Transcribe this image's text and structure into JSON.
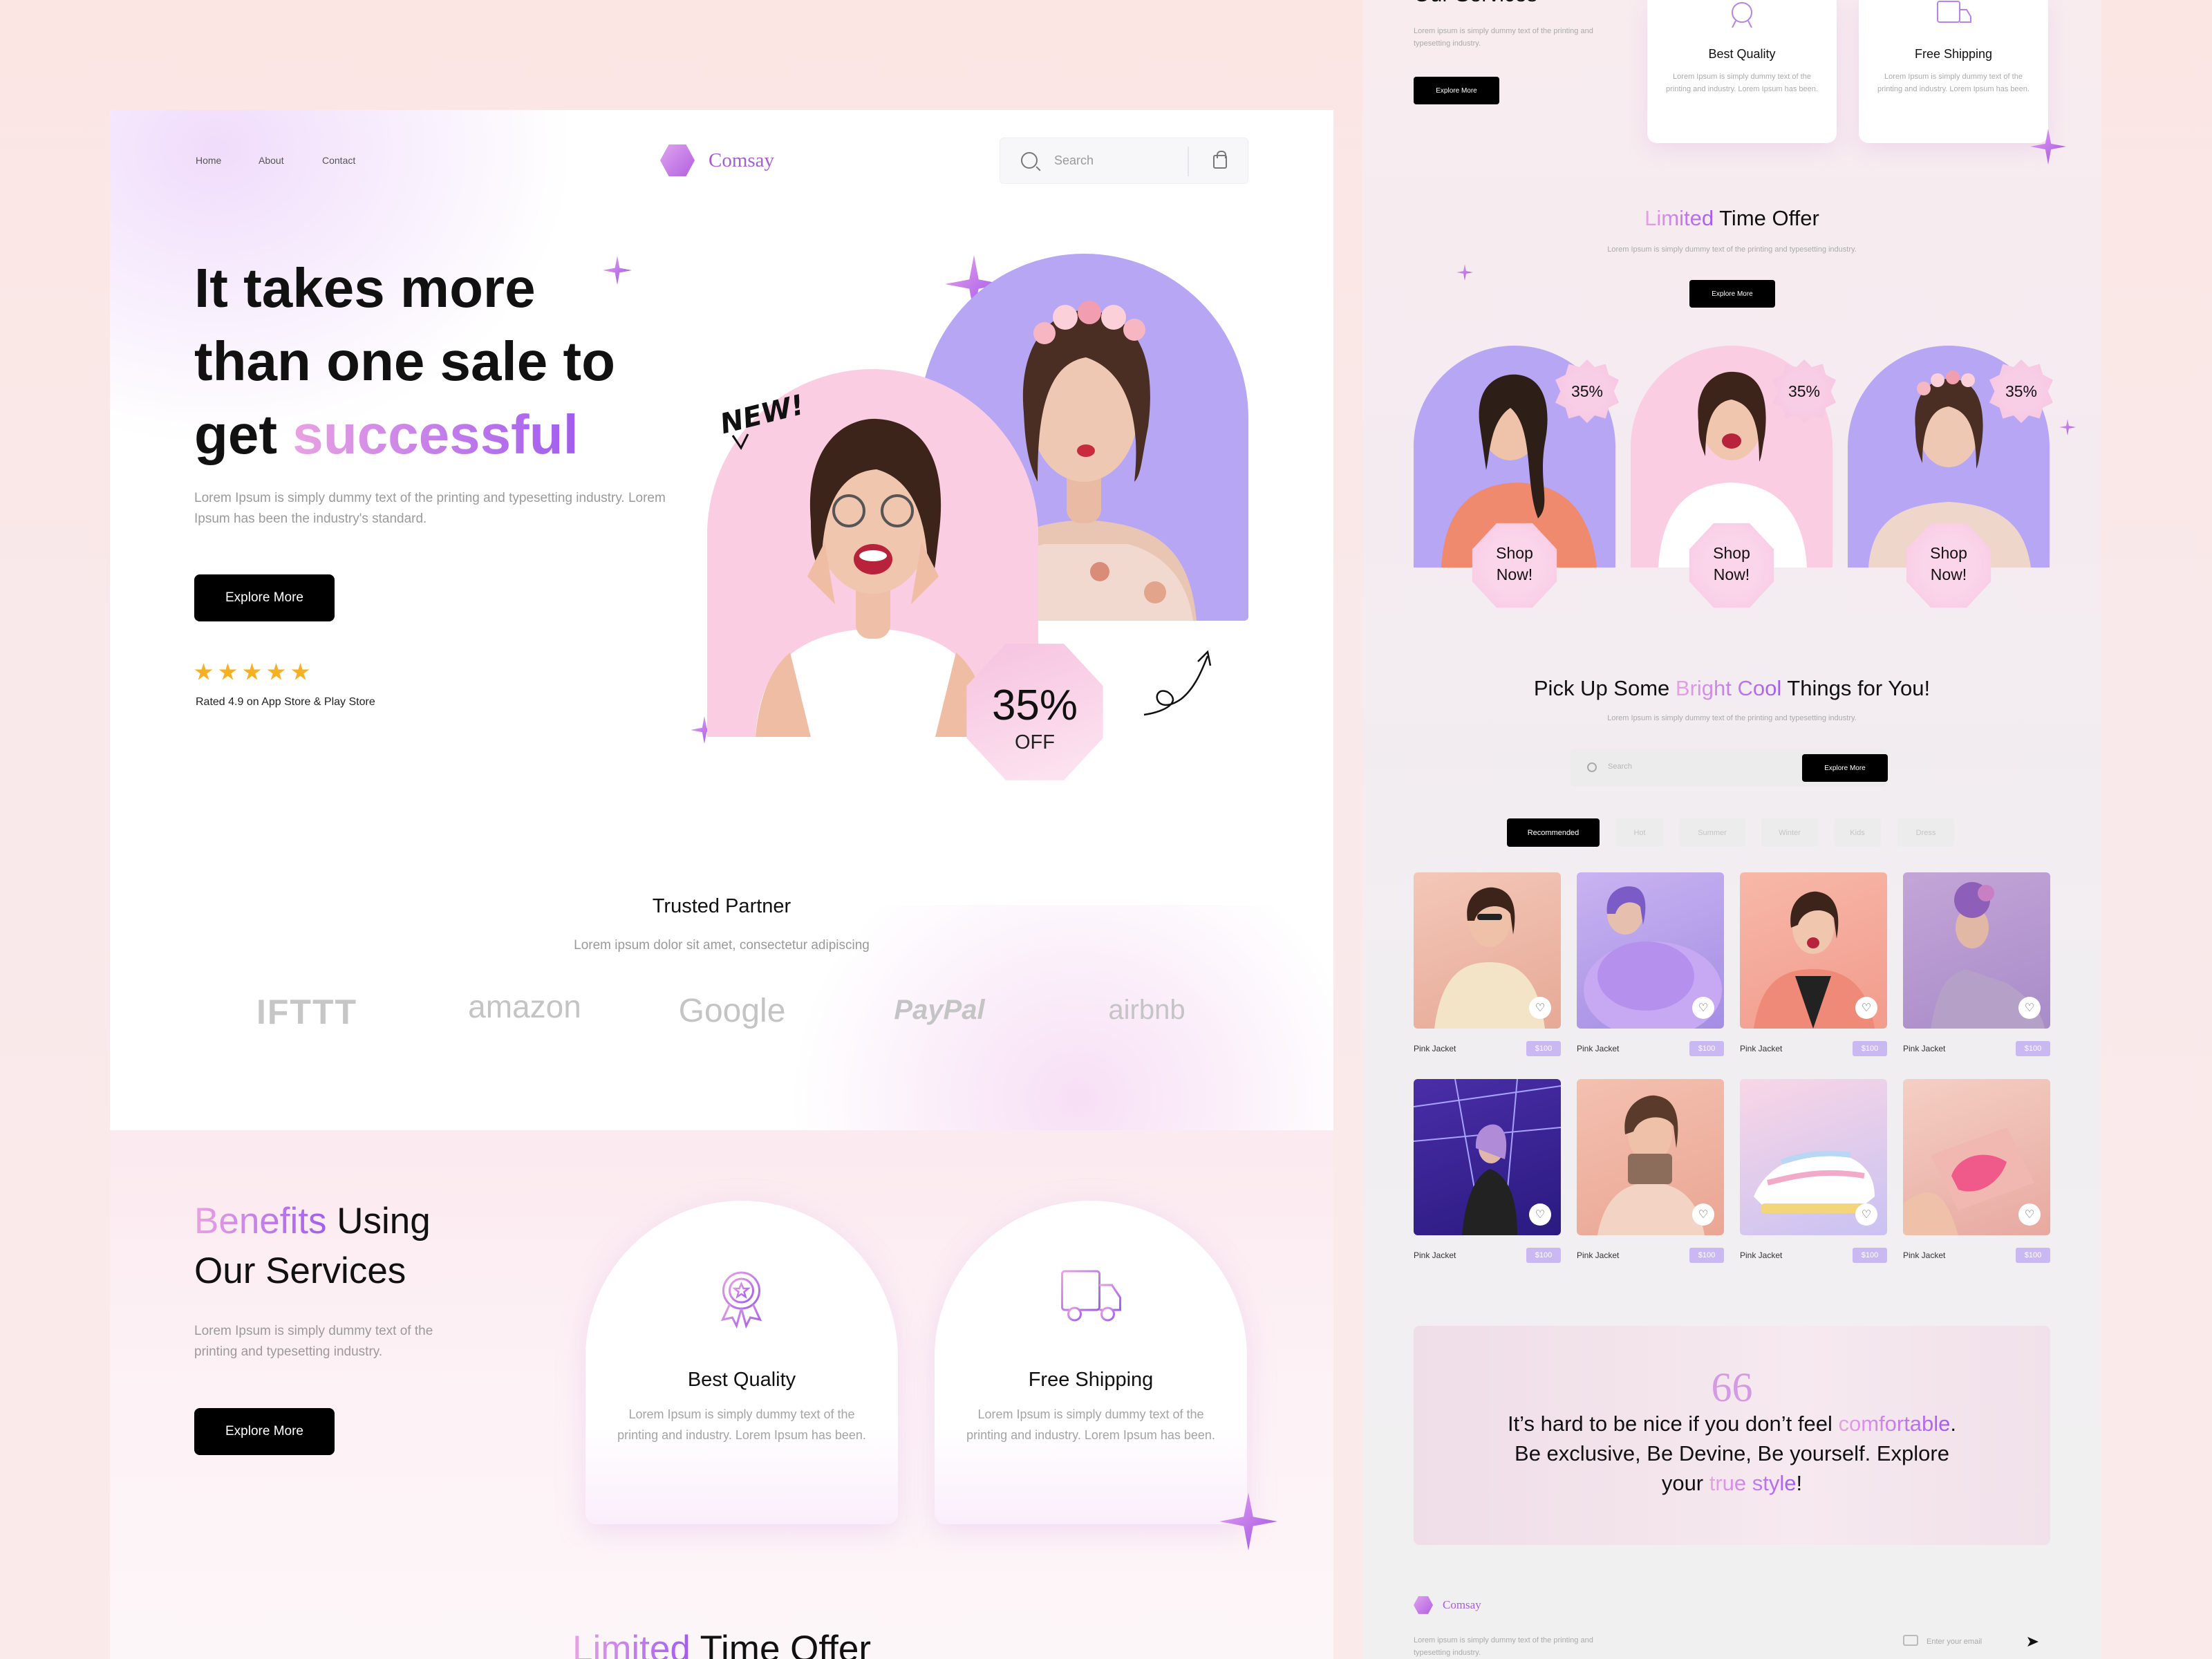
{
  "left": {
    "nav": {
      "home": "Home",
      "about": "About",
      "contact": "Contact"
    },
    "brand": "Comsay",
    "search": {
      "placeholder": "Search"
    },
    "hero": {
      "title_line1": "It takes more",
      "title_line2": "than one sale to",
      "title_line3_plain": "get ",
      "title_line3_accent": "successful",
      "subtitle": "Lorem Ipsum is simply dummy text of the printing and typesetting industry. Lorem Ipsum has been the industry's standard.",
      "cta": "Explore More",
      "rating_stars": 5,
      "rating_text": "Rated 4.9 on App Store & Play Store",
      "new_tag": "NEW!",
      "discount_value": "35%",
      "discount_label": "OFF"
    },
    "trusted": {
      "title": "Trusted Partner",
      "subtitle": "Lorem ipsum dolor sit amet, consectetur adipiscing",
      "logos": [
        "IFTTT",
        "amazon",
        "Google",
        "PayPal",
        "airbnb"
      ]
    },
    "benefits": {
      "title_accent": "Benefits",
      "title_rest1": " Using",
      "title_rest2": "Our Services",
      "subtitle": "Lorem Ipsum is simply dummy text of the printing and typesetting industry.",
      "cta": "Explore More",
      "cards": [
        {
          "icon": "award-icon",
          "title": "Best Quality",
          "desc": "Lorem Ipsum is simply dummy text of the printing and industry. Lorem Ipsum has been."
        },
        {
          "icon": "truck-icon",
          "title": "Free Shipping",
          "desc": "Lorem Ipsum is simply dummy text of the printing and industry. Lorem Ipsum has been."
        }
      ]
    },
    "offer": {
      "accent": "Limited",
      "rest": " Time Offer"
    }
  },
  "right": {
    "services": {
      "title": "Our Services",
      "subtitle": "Lorem ipsum is simply dummy text of the printing and typesetting industry.",
      "cta": "Explore More",
      "cards": [
        {
          "title": "Best Quality",
          "desc": "Lorem Ipsum is simply dummy text of the printing and industry. Lorem Ipsum has been."
        },
        {
          "title": "Free Shipping",
          "desc": "Lorem Ipsum is simply dummy text of the printing and industry. Lorem Ipsum has been."
        }
      ]
    },
    "offer": {
      "accent": "Limited",
      "rest": " Time Offer",
      "subtitle": "Lorem Ipsum is simply dummy text of the printing and typesetting industry.",
      "cta": "Explore More",
      "items": [
        {
          "discount": "35%",
          "shop_line1": "Shop",
          "shop_line2": "Now!"
        },
        {
          "discount": "35%",
          "shop_line1": "Shop",
          "shop_line2": "Now!"
        },
        {
          "discount": "35%",
          "shop_line1": "Shop",
          "shop_line2": "Now!"
        }
      ]
    },
    "pick": {
      "title_plain1": "Pick Up Some ",
      "title_accent": "Bright Cool",
      "title_plain2": " Things for You!",
      "subtitle": "Lorem Ipsum is simply dummy text of the printing and typesetting industry.",
      "search_placeholder": "Search",
      "search_cta": "Explore More",
      "tabs": [
        "Recommended",
        "Hot",
        "Summer",
        "Winter",
        "Kids",
        "Dress"
      ],
      "products": [
        {
          "name": "Pink Jacket",
          "price": "$100"
        },
        {
          "name": "Pink Jacket",
          "price": "$100"
        },
        {
          "name": "Pink Jacket",
          "price": "$100"
        },
        {
          "name": "Pink Jacket",
          "price": "$100"
        },
        {
          "name": "Pink Jacket",
          "price": "$100"
        },
        {
          "name": "Pink Jacket",
          "price": "$100"
        },
        {
          "name": "Pink Jacket",
          "price": "$100"
        },
        {
          "name": "Pink Jacket",
          "price": "$100"
        }
      ]
    },
    "quote": {
      "mark": "66",
      "line1_plain": "It’s hard to be nice if you don’t feel ",
      "line1_accent": "comfortable",
      "line1_end": ".",
      "line2": "Be exclusive, Be Devine, Be yourself. Explore",
      "line3_plain": "your ",
      "line3_accent": "true style",
      "line3_end": "!"
    },
    "footer": {
      "brand": "Comsay",
      "desc": "Lorem ipsum is simply dummy text of the printing and typesetting industry.",
      "email_placeholder": "Enter your email"
    }
  },
  "colors": {
    "accent_start": "#e9a2e2",
    "accent_end": "#a15cf0",
    "purple_arch": "#b7a6f4",
    "pink_arch": "#fbcde2",
    "star": "#f5b024"
  }
}
